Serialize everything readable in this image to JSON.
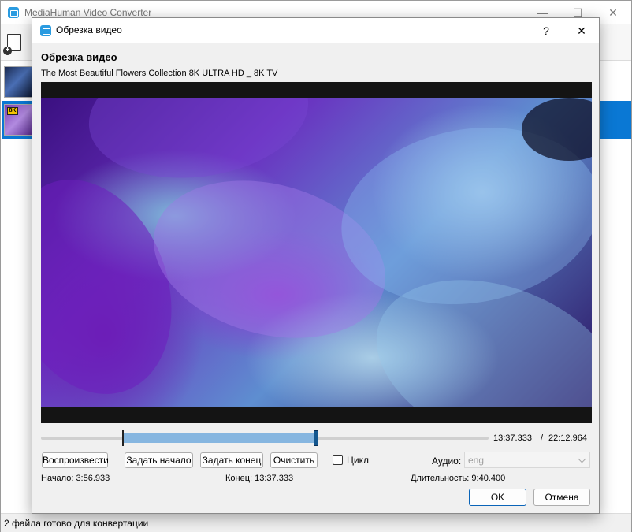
{
  "main_window": {
    "title": "MediaHuman Video Converter",
    "controls": {
      "minimize": "—",
      "maximize": "☐",
      "close": "✕"
    },
    "status_text": "2 файла готово для конвертации"
  },
  "dialog": {
    "title": "Обрезка видео",
    "help": "?",
    "close": "✕",
    "heading": "Обрезка видео",
    "video_name": "The Most Beautiful Flowers Collection 8K ULTRA HD _ 8K TV",
    "timeline": {
      "current_time": "13:37.333",
      "separator": "/",
      "total_time": "22:12.964",
      "start_fraction": 0.183,
      "end_fraction": 0.615
    },
    "buttons": {
      "play": "Воспроизвести",
      "set_start": "Задать начало",
      "set_end": "Задать конец",
      "clear": "Очистить",
      "ok": "OK",
      "cancel": "Отмена"
    },
    "loop": {
      "label": "Цикл",
      "checked": false
    },
    "audio": {
      "label": "Аудио:",
      "value": "eng"
    },
    "info": {
      "start": "Начало: 3:56.933",
      "end": "Конец: 13:37.333",
      "duration": "Длительность: 9:40.400"
    }
  },
  "colors": {
    "accent": "#0a78d4",
    "selection": "#86b6e0",
    "handle": "#14578f"
  }
}
